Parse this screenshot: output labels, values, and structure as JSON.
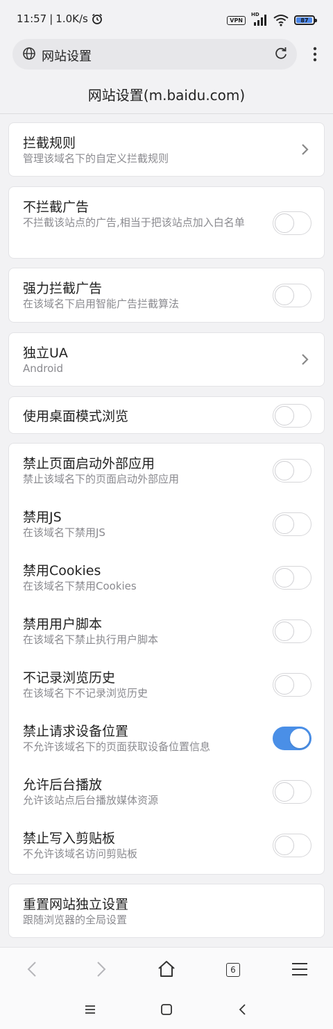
{
  "status_bar": {
    "time": "11:57",
    "speed": "1.0K/s",
    "vpn": "VPN",
    "hd": "HD",
    "battery": "87",
    "battery_level": 0.87,
    "icons": [
      "alarm-icon",
      "signal-icon",
      "wifi-icon",
      "battery-icon"
    ]
  },
  "url_bar": {
    "text": "网站设置",
    "icons": [
      "globe-icon",
      "refresh-icon",
      "more-vert-icon"
    ]
  },
  "page": {
    "title": "网站设置(m.baidu.com)"
  },
  "settings": {
    "block_rules": {
      "title": "拦截规则",
      "subtitle": "管理该域名下的自定义拦截规则"
    },
    "no_block_ads": {
      "title": "不拦截广告",
      "subtitle": "不拦截该站点的广告,相当于把该站点加入白名单",
      "enabled": false
    },
    "strong_block_ads": {
      "title": "强力拦截广告",
      "subtitle": "在该域名下启用智能广告拦截算法",
      "enabled": false
    },
    "custom_ua": {
      "title": "独立UA",
      "subtitle": "Android"
    },
    "desktop_mode": {
      "title": "使用桌面模式浏览",
      "enabled": false
    },
    "group": [
      {
        "title": "禁止页面启动外部应用",
        "subtitle": "禁止该域名下的页面启动外部应用",
        "enabled": false
      },
      {
        "title": "禁用JS",
        "subtitle": "在该域名下禁用JS",
        "enabled": false
      },
      {
        "title": "禁用Cookies",
        "subtitle": "在该域名下禁用Cookies",
        "enabled": false
      },
      {
        "title": "禁用用户脚本",
        "subtitle": "在该域名下禁止执行用户脚本",
        "enabled": false
      },
      {
        "title": "不记录浏览历史",
        "subtitle": "在该域名下不记录浏览历史",
        "enabled": false
      },
      {
        "title": "禁止请求设备位置",
        "subtitle": "不允许该域名下的页面获取设备位置信息",
        "enabled": true
      },
      {
        "title": "允许后台播放",
        "subtitle": "允许该站点后台播放媒体资源",
        "enabled": false
      },
      {
        "title": "禁止写入剪贴板",
        "subtitle": "不允许该域名访问剪贴板",
        "enabled": false
      }
    ],
    "reset": {
      "title": "重置网站独立设置",
      "subtitle": "跟随浏览器的全局设置"
    }
  },
  "toolbar": {
    "tab_count": "6",
    "icons": [
      "back-icon",
      "forward-icon",
      "home-icon",
      "tabs-icon",
      "menu-icon"
    ]
  },
  "colors": {
    "accent": "#4a8fe7",
    "background": "#f2f2f4",
    "card": "#ffffff",
    "subtitle": "#8a8a8f"
  }
}
